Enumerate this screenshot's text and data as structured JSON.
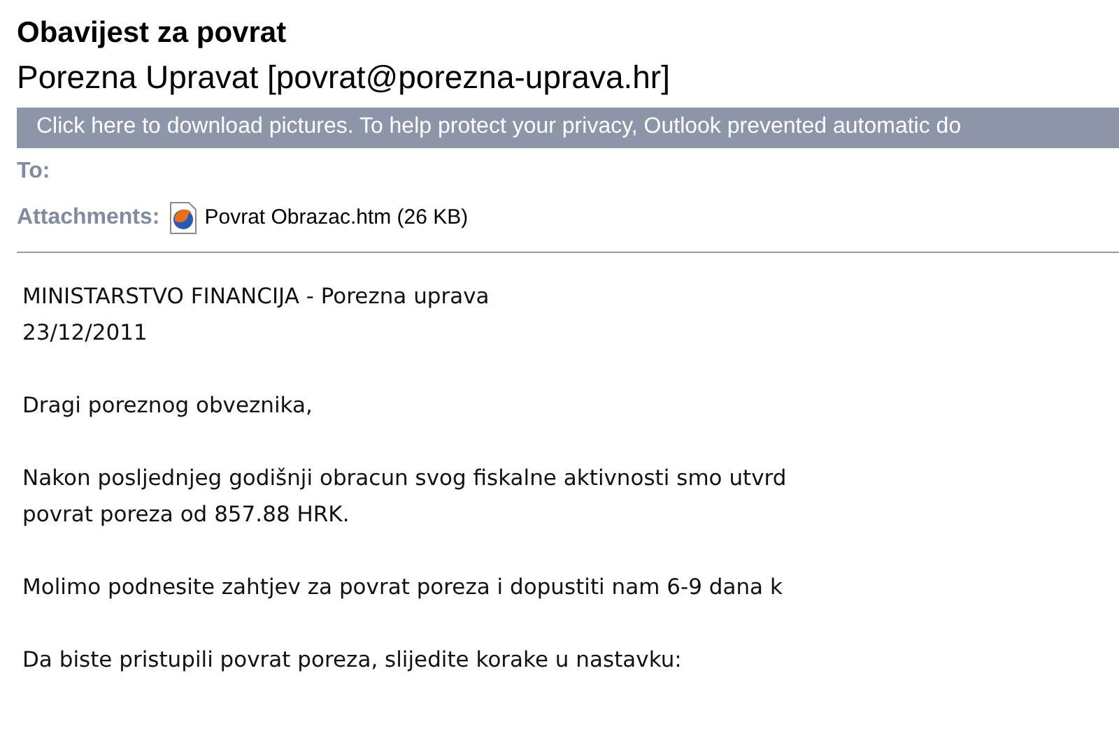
{
  "subject": "Obavijest za povrat",
  "sender": "Porezna Upravat [povrat@porezna-uprava.hr]",
  "info_bar": "Click here to download pictures. To help protect your privacy, Outlook prevented automatic do",
  "fields": [
    {
      "label": "To:"
    },
    {
      "label": "Attachments:",
      "attachment": "Povrat Obrazac.htm (26 KB)"
    }
  ],
  "body": [
    [
      "MINISTARSTVO FINANCIJA - Porezna uprava",
      "23/12/2011"
    ],
    [
      "Dragi poreznog obveznika,"
    ],
    [
      "Nakon posljednjeg godišnji obracun svog fiskalne aktivnosti smo utvrd",
      "povrat poreza od 857.88 HRK."
    ],
    [
      "Molimo podnesite zahtjev za povrat poreza i dopustiti nam 6-9 dana k"
    ],
    [
      "Da biste pristupili povrat poreza, slijedite korake u nastavku:"
    ]
  ]
}
